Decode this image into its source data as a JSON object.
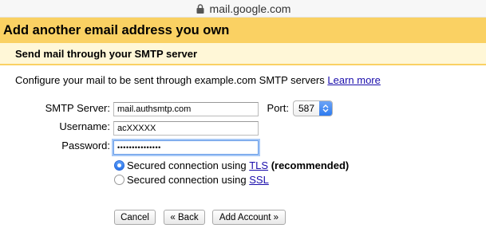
{
  "browser": {
    "url": "mail.google.com"
  },
  "dialog": {
    "title": "Add another email address you own",
    "subtitle": "Send mail through your SMTP server",
    "description_prefix": "Configure your mail to be sent through example.com  SMTP servers ",
    "learn_more": "Learn more"
  },
  "form": {
    "smtp_label": "SMTP Server:",
    "smtp_value": "mail.authsmtp.com",
    "port_label": "Port:",
    "port_value": "587",
    "username_label": "Username:",
    "username_value": "acXXXXX",
    "password_label": "Password:",
    "password_value": "•••••••••••••••"
  },
  "security": {
    "tls_prefix": "Secured connection using ",
    "tls_link": "TLS",
    "tls_suffix": " (recommended)",
    "ssl_prefix": "Secured connection using ",
    "ssl_link": "SSL",
    "selected": "TLS"
  },
  "buttons": {
    "cancel": "Cancel",
    "back": "« Back",
    "add_account": "Add Account »"
  },
  "colors": {
    "title_bg": "#fad163",
    "subtitle_bg": "#fff7d7",
    "link": "#1a0dab"
  }
}
